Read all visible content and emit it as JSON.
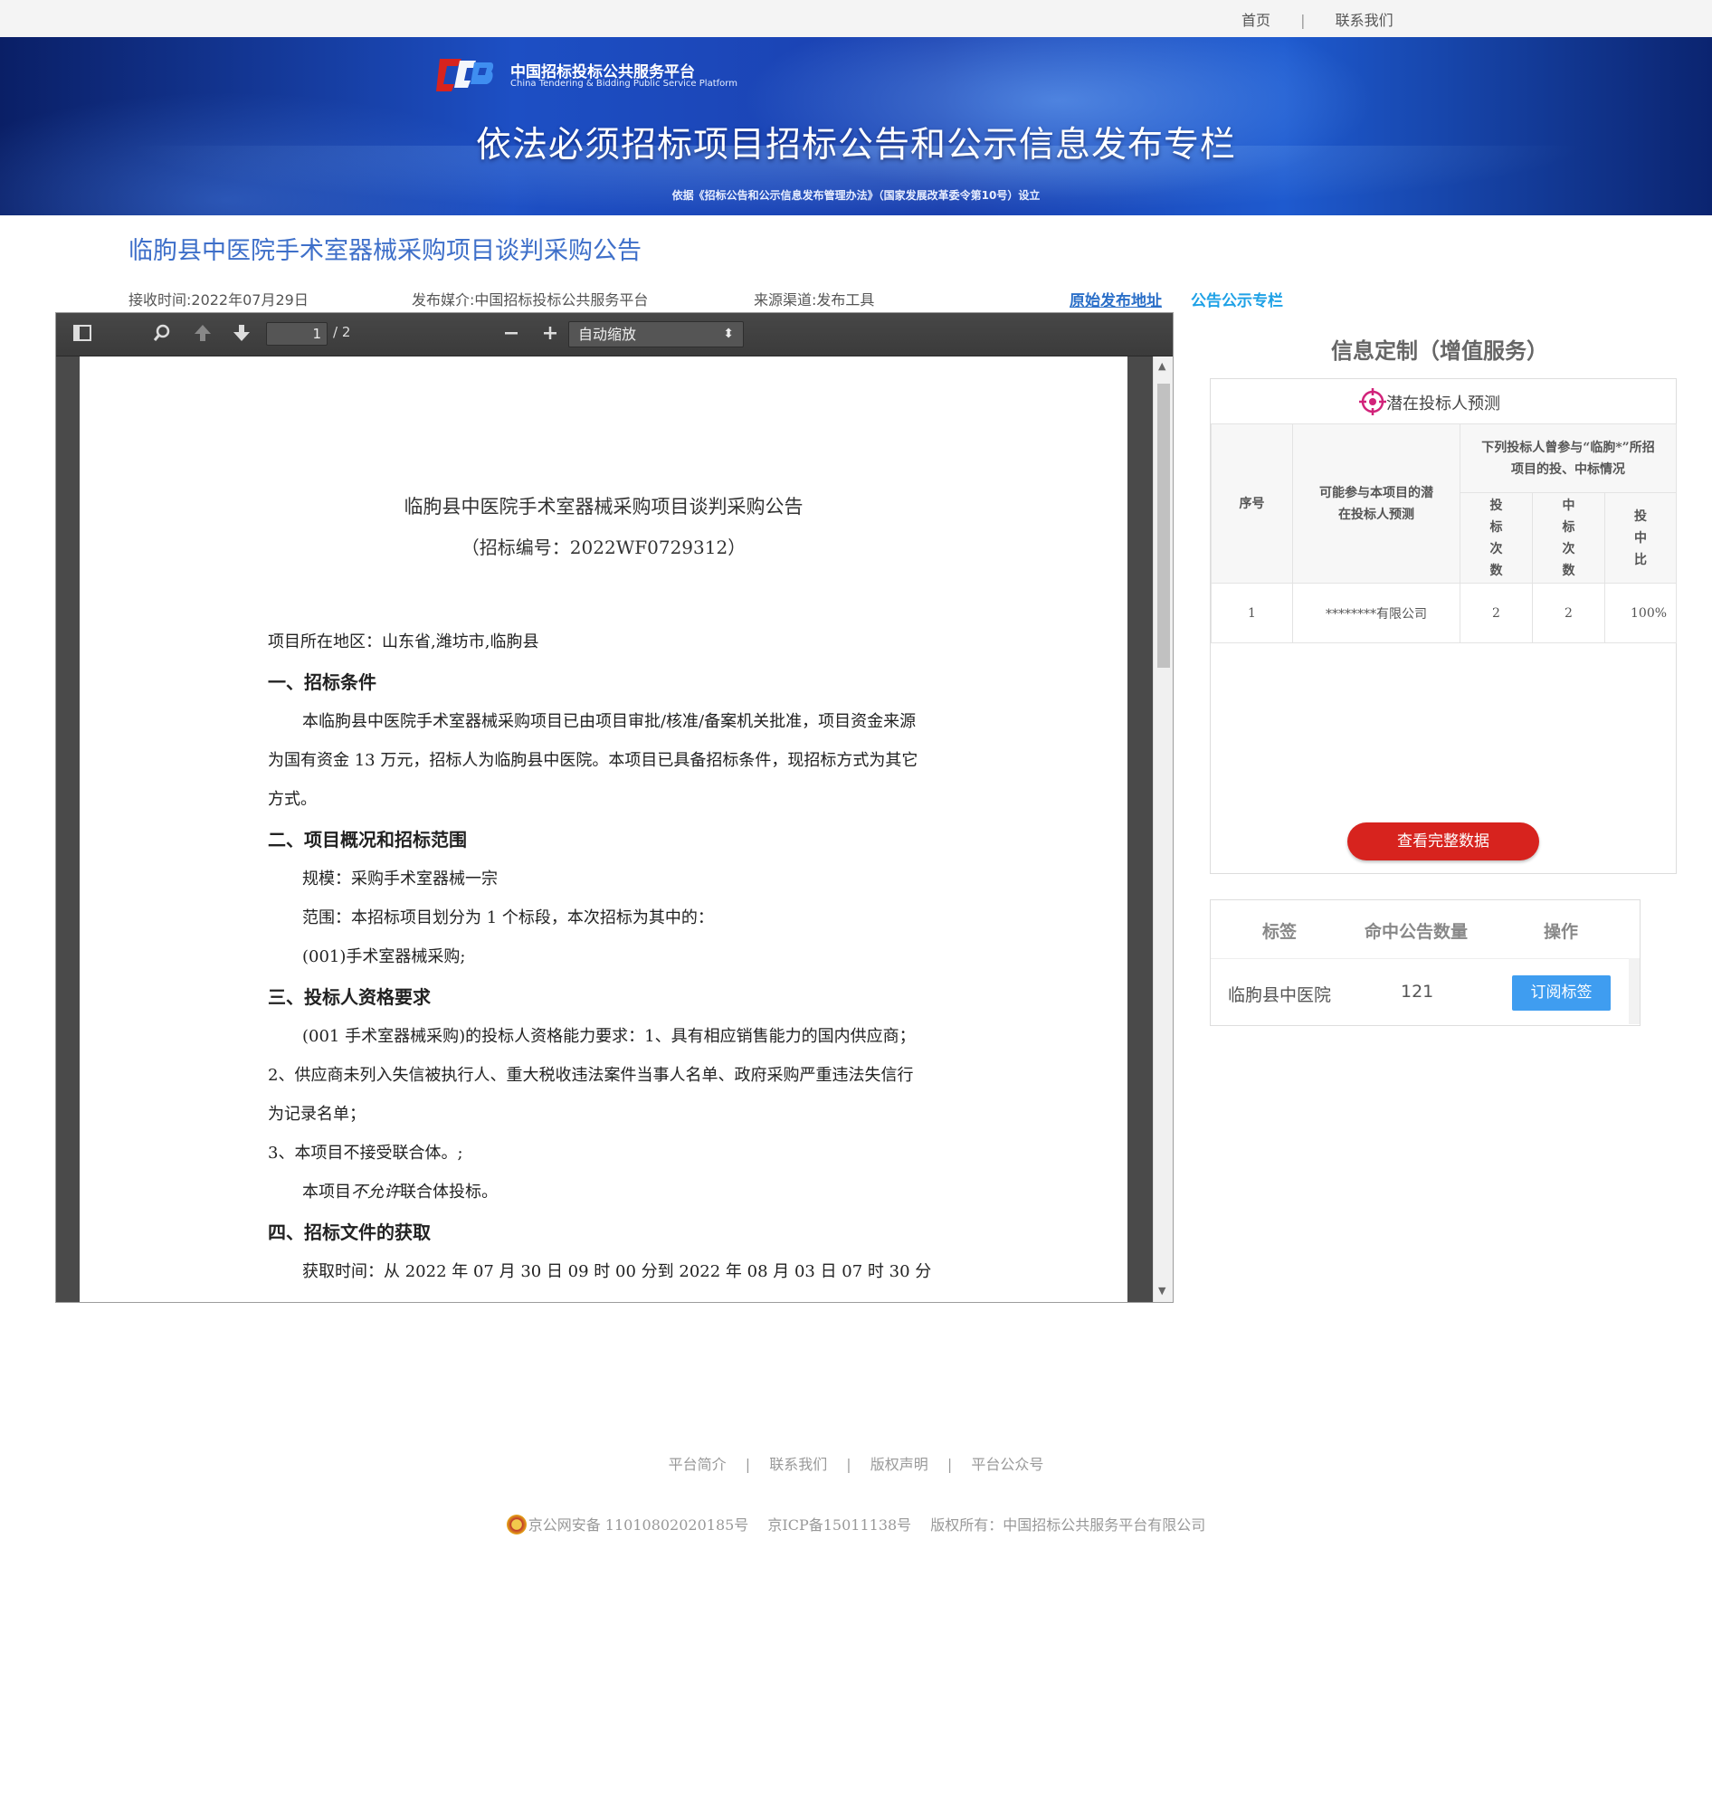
{
  "topnav": {
    "home": "首页",
    "sep": "|",
    "contact": "联系我们"
  },
  "banner": {
    "platform_cn": "中国招标投标公共服务平台",
    "platform_en": "China Tendering & Bidding Public Service Platform",
    "title": "依法必须招标项目招标公告和公示信息发布专栏",
    "subtitle": "依据《招标公告和公示信息发布管理办法》（国家发展改革委令第10号）设立",
    "accent": "#d7231e"
  },
  "doc": {
    "title": "临朐县中医院手术室器械采购项目谈判采购公告",
    "received": "接收时间:2022年07月29日",
    "media": "发布媒介:中国招标投标公共服务平台",
    "source": "来源渠道:发布工具",
    "link_original": "原始发布地址",
    "link_column": "公告公示专栏"
  },
  "viewer": {
    "icons": [
      "sidebar-toggle-icon",
      "search-icon",
      "prev-page-icon",
      "next-page-icon",
      "zoom-out-icon",
      "zoom-in-icon"
    ],
    "page_current": "1",
    "page_total": "/ 2",
    "zoom": "自动缩放",
    "pdf": {
      "title": "临朐县中医院手术室器械采购项目谈判采购公告",
      "code": "（招标编号：2022WF0729312）",
      "lines": [
        "项目所在地区：山东省,潍坊市,临朐县",
        "一、招标条件",
        "本临朐县中医院手术室器械采购项目已由项目审批/核准/备案机关批准，项目资金来源",
        "为国有资金 13 万元，招标人为临朐县中医院。本项目已具备招标条件，现招标方式为其它",
        "方式。",
        "二、项目概况和招标范围",
        "规模：采购手术室器械一宗",
        "范围：本招标项目划分为 1 个标段，本次招标为其中的：",
        "(001)手术室器械采购;",
        "三、投标人资格要求",
        "(001 手术室器械采购)的投标人资格能力要求：1、具有相应销售能力的国内供应商；",
        "2、供应商未列入失信被执行人、重大税收违法案件当事人名单、政府采购严重违法失信行",
        "为记录名单；",
        "3、本项目不接受联合体。;",
        "本项目",
        "不允许",
        "联合体投标。",
        "四、招标文件的获取",
        "获取时间：从 2022 年 07 月 30 日 09 时 00 分到 2022 年 08 月 03 日 07 时 30 分"
      ]
    }
  },
  "side": {
    "title": "信息定制（增值服务）",
    "pred_label": "潜在投标人预测",
    "table": {
      "h_no": "序号",
      "h_bidder": "可能参与本项目的潜在投标人预测",
      "h_group": "下列投标人曾参与“临朐*”所招项目的投、中标情况",
      "h_bids": "投标次数",
      "h_wins": "中标次数",
      "h_ratio": "投中比",
      "rows": [
        {
          "no": "1",
          "name": "********有限公司",
          "bids": "2",
          "wins": "2",
          "ratio": "100%"
        }
      ]
    },
    "btn_full": "查看完整数据",
    "tags": {
      "h_tag": "标签",
      "h_count": "命中公告数量",
      "h_action": "操作",
      "rows": [
        {
          "tag": "临朐县中医院",
          "count": "121",
          "action": "订阅标签"
        }
      ]
    }
  },
  "footer": {
    "links": [
      "平台简介",
      "联系我们",
      "版权声明",
      "平台公众号"
    ],
    "sep": "|",
    "beian": "京公网安备 11010802020185号",
    "icp": "京ICP备15011138号",
    "copyright": "版权所有：中国招标公共服务平台有限公司"
  }
}
